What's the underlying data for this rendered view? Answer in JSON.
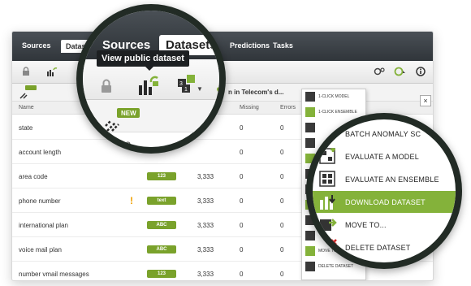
{
  "app": {
    "nav": {
      "sources": "Sources",
      "datasets": "Datasets",
      "predictions": "Predictions",
      "tasks": "Tasks"
    },
    "subbar_text": "n in Telecom's d...",
    "columns": {
      "name": "Name",
      "missing": "Missing",
      "errors": "Errors"
    },
    "rows": [
      {
        "name": "state",
        "badge": "",
        "count": "",
        "missing": "0",
        "errors": "0",
        "warn": false
      },
      {
        "name": "account length",
        "badge": "",
        "count": "",
        "missing": "0",
        "errors": "0",
        "warn": false
      },
      {
        "name": "area code",
        "badge": "123",
        "count": "3,333",
        "missing": "0",
        "errors": "0",
        "warn": false
      },
      {
        "name": "phone number",
        "badge": "text",
        "count": "3,333",
        "missing": "0",
        "errors": "0",
        "warn": true
      },
      {
        "name": "international plan",
        "badge": "ABC",
        "count": "3,333",
        "missing": "0",
        "errors": "0",
        "warn": false
      },
      {
        "name": "voice mail plan",
        "badge": "ABC",
        "count": "3,333",
        "missing": "0",
        "errors": "0",
        "warn": false
      },
      {
        "name": "number vmail messages",
        "badge": "123",
        "count": "3,333",
        "missing": "0",
        "errors": "0",
        "warn": false
      }
    ],
    "bg_menu": [
      "1-CLICK MODEL",
      "1-CLICK ENSEMBLE",
      "",
      "",
      "",
      "",
      "",
      "",
      "",
      "",
      "MOVE TO...",
      "DELETE DATASET"
    ],
    "bg_count_col": "3,333"
  },
  "lens_left": {
    "sources": "Sources",
    "datasets": "Datasets",
    "tooltip": "View public dataset",
    "new_badge": "NEW",
    "name_col": "Name"
  },
  "lens_right": {
    "items": [
      {
        "label": "BATCH ANOMALY SC",
        "active": false
      },
      {
        "label": "EVALUATE A MODEL",
        "active": false
      },
      {
        "label": "EVALUATE AN ENSEMBLE",
        "active": false
      },
      {
        "label": "DOWNLOAD DATASET",
        "active": true
      },
      {
        "label": "MOVE TO...",
        "active": false
      },
      {
        "label": "DELETE DATASET",
        "active": false
      }
    ]
  },
  "colors": {
    "accent": "#84b23a",
    "nav_dark": "#30353a",
    "lens_border": "#222b25",
    "warn": "#f0a000"
  }
}
